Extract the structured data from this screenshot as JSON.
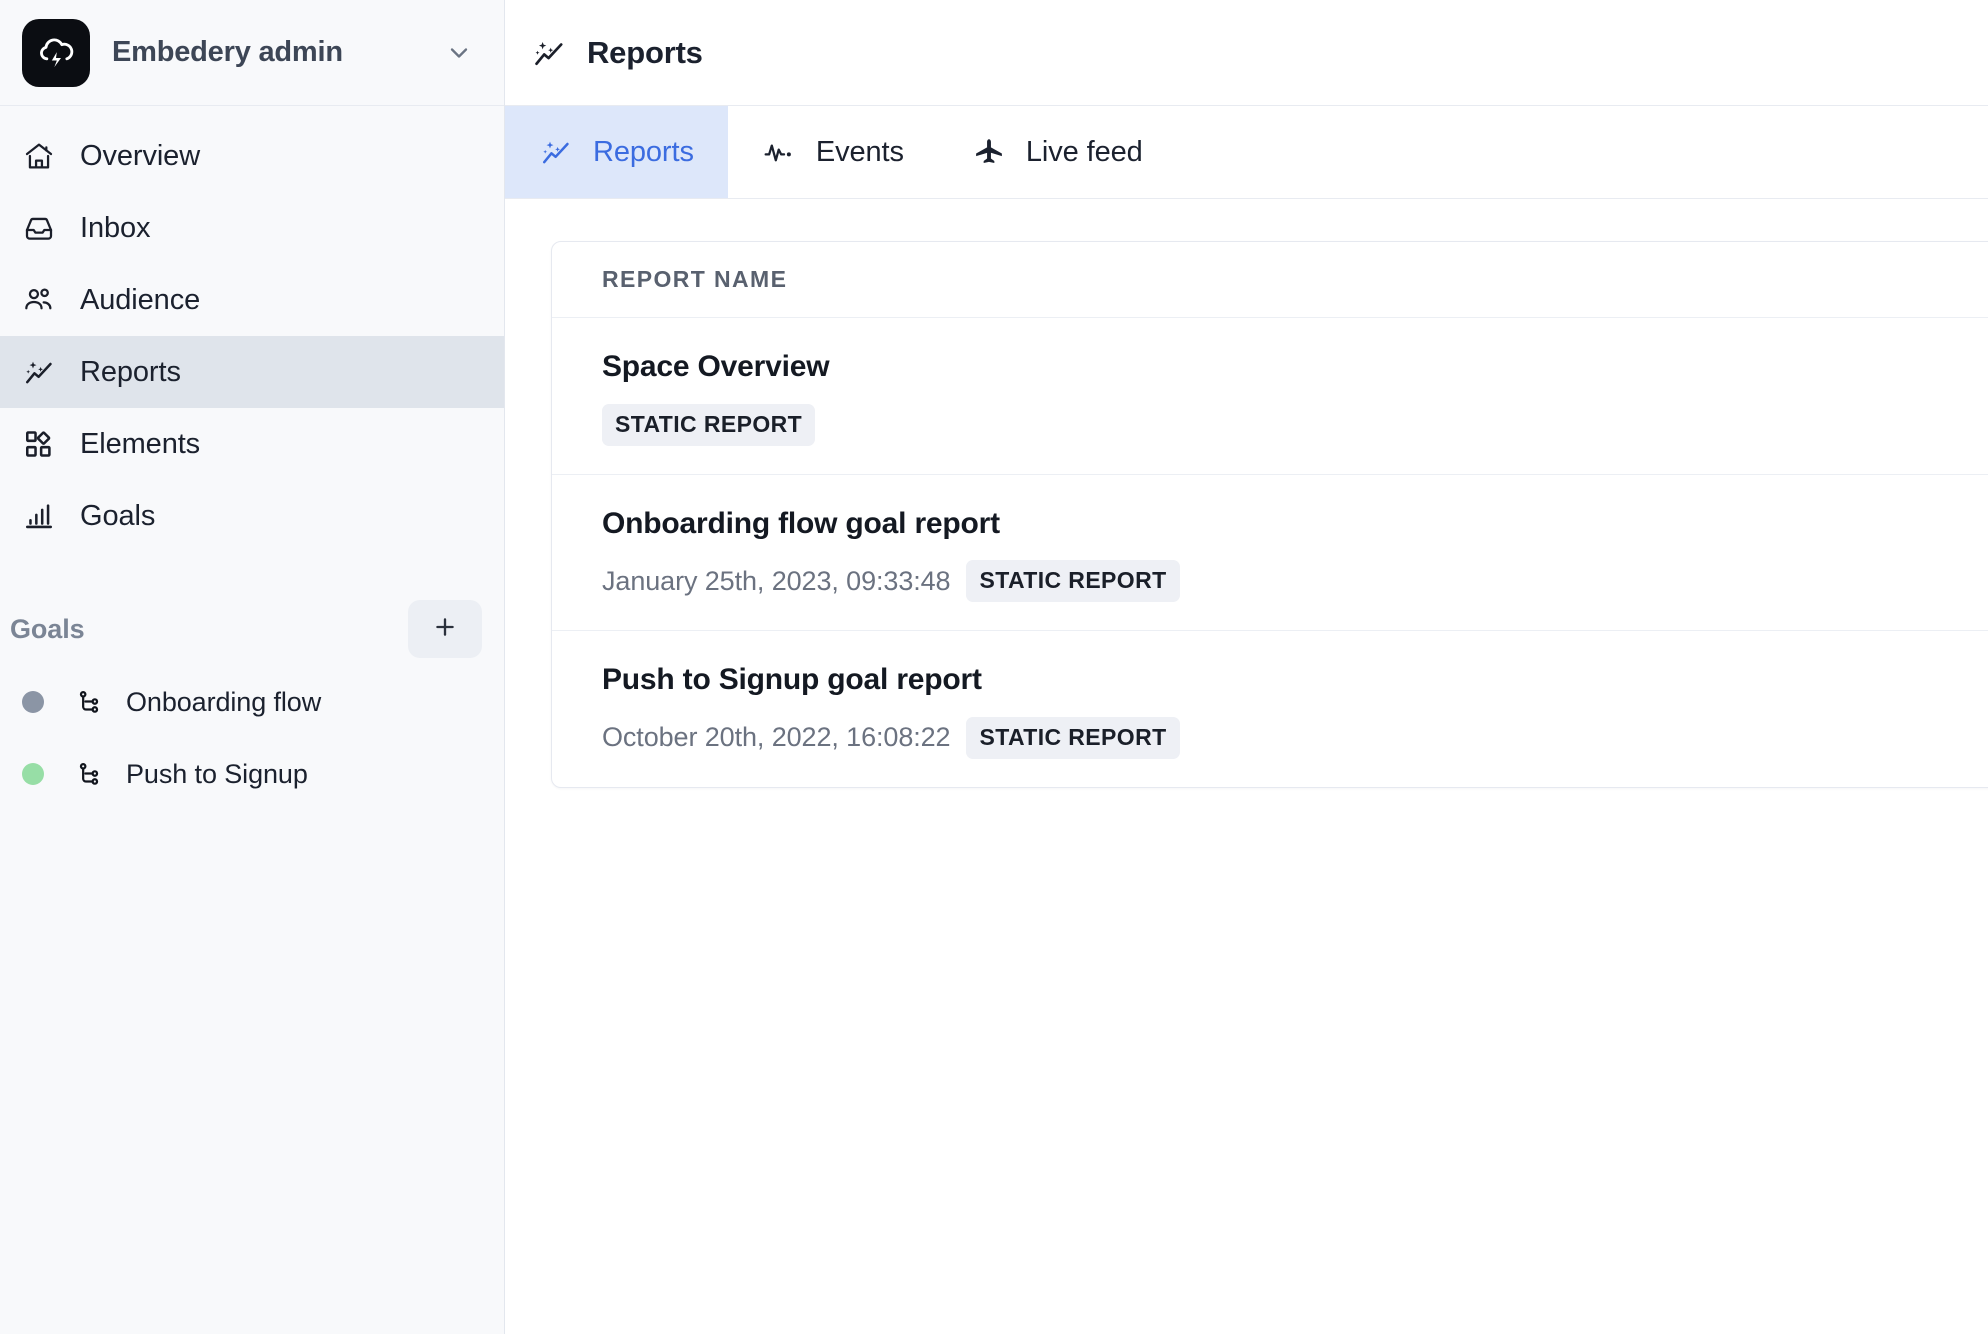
{
  "workspace": {
    "name": "Embedery admin",
    "logo_icon": "cloud-lightning-icon",
    "chevron_icon": "chevron-down-icon",
    "logo_bg": "#0b0d12"
  },
  "sidebar": {
    "nav_items": [
      {
        "label": "Overview",
        "icon": "home-icon",
        "active": false
      },
      {
        "label": "Inbox",
        "icon": "inbox-icon",
        "active": false
      },
      {
        "label": "Audience",
        "icon": "users-icon",
        "active": false
      },
      {
        "label": "Reports",
        "icon": "sparkle-chart-icon",
        "active": true
      },
      {
        "label": "Elements",
        "icon": "grid-elements-icon",
        "active": false
      },
      {
        "label": "Goals",
        "icon": "bar-chart-icon",
        "active": false
      }
    ],
    "section": {
      "title": "Goals",
      "add_icon": "plus-icon"
    },
    "goals": [
      {
        "label": "Onboarding flow",
        "icon": "git-branch-icon",
        "dot_color": "#8b95a5"
      },
      {
        "label": "Push to Signup",
        "icon": "git-branch-icon",
        "dot_color": "#97dea6"
      }
    ]
  },
  "header": {
    "title": "Reports",
    "icon": "sparkle-chart-icon"
  },
  "tabs": [
    {
      "label": "Reports",
      "icon": "sparkle-chart-icon",
      "active": true
    },
    {
      "label": "Events",
      "icon": "activity-pulse-icon",
      "active": false
    },
    {
      "label": "Live feed",
      "icon": "airplane-icon",
      "active": false
    }
  ],
  "reports_table": {
    "column_header": "REPORT NAME",
    "rows": [
      {
        "name": "Space Overview",
        "date": "",
        "badge": "STATIC REPORT"
      },
      {
        "name": "Onboarding flow goal report",
        "date": "January 25th, 2023, 09:33:48",
        "badge": "STATIC REPORT"
      },
      {
        "name": "Push to Signup goal report",
        "date": "October 20th, 2022, 16:08:22",
        "badge": "STATIC REPORT"
      }
    ]
  },
  "colors": {
    "accent_blue": "#3b6ce0",
    "tab_active_bg": "#dde7fa",
    "sidebar_bg": "#f8f9fb",
    "nav_active_bg": "#dfe4eb",
    "badge_bg": "#eef0f5"
  }
}
